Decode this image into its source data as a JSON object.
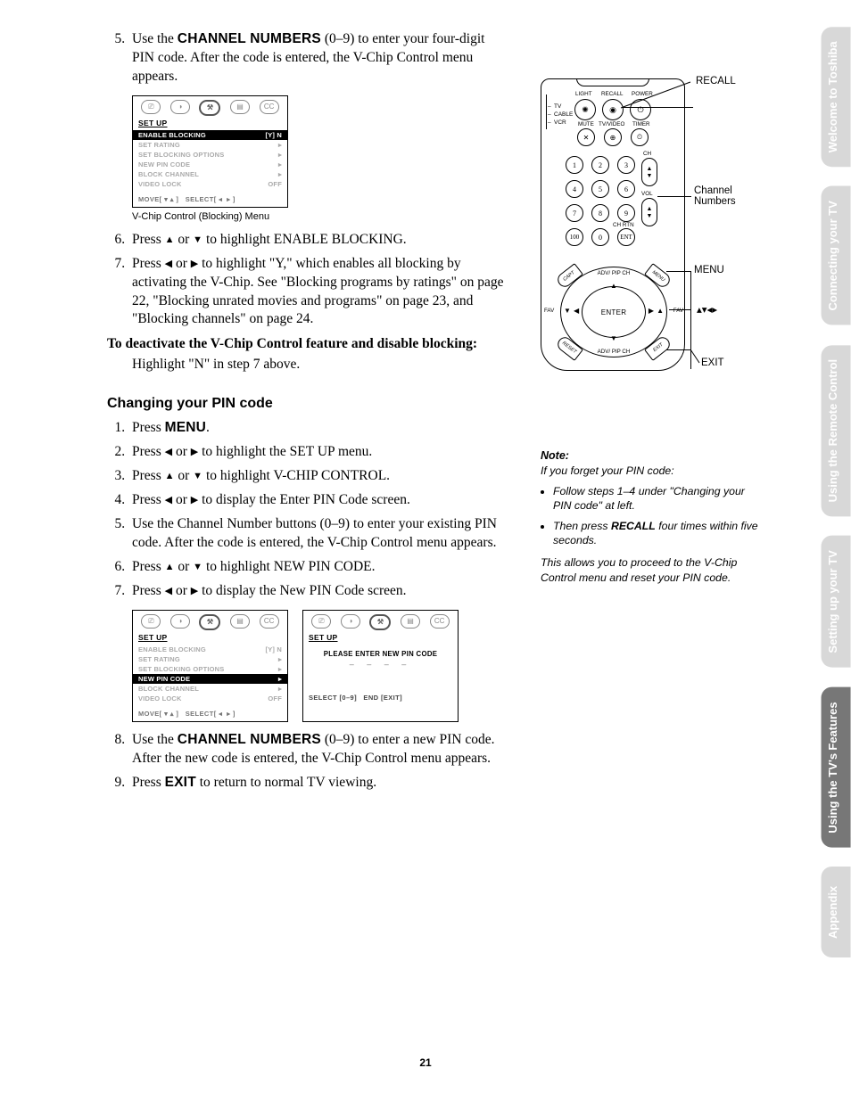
{
  "sidebar": {
    "tabs": [
      {
        "l1": "Welcome to",
        "l2": "Toshiba",
        "active": false
      },
      {
        "l1": "Connecting",
        "l2": "your TV",
        "active": false
      },
      {
        "l1": "Using the",
        "l2": "Remote Control",
        "active": false
      },
      {
        "l1": "Setting up",
        "l2": "your TV",
        "active": false
      },
      {
        "l1": "Using the TV's",
        "l2": "Features",
        "active": true
      },
      {
        "l1": "Appendix",
        "l2": "",
        "active": false
      }
    ]
  },
  "left": {
    "step5a": "Use the ",
    "step5b": "CHANNEL NUMBERS",
    "step5c": " (0–9) to enter your four-digit PIN code. After the code is entered, the V-Chip Control menu appears.",
    "osd1_caption": "V-Chip Control (Blocking) Menu",
    "step6a": "Press ",
    "step6b": " or ",
    "step6c": " to highlight ENABLE BLOCKING.",
    "step7a": "Press ",
    "step7b": " or ",
    "step7c": " to highlight \"Y,\" which enables all blocking by activating the V-Chip. See \"Blocking programs by ratings\" on page 22, \"Blocking unrated movies and programs\" on page 23, and \"Blocking channels\" on page 24.",
    "deact_title": "To deactivate the V-Chip Control feature and disable blocking:",
    "deact_body": "Highlight \"N\" in step 7 above.",
    "section2": "Changing your PIN code",
    "s2_1a": "Press ",
    "s2_1b": "MENU",
    "s2_1c": ".",
    "s2_2a": "Press ",
    "s2_2b": " or ",
    "s2_2c": " to highlight the SET UP menu.",
    "s2_3a": "Press ",
    "s2_3b": " or ",
    "s2_3c": " to highlight V-CHIP CONTROL.",
    "s2_4a": "Press ",
    "s2_4b": " or ",
    "s2_4c": " to display the Enter PIN Code screen.",
    "s2_5": "Use the Channel Number buttons (0–9) to enter your existing PIN code. After the code is entered, the V-Chip Control menu appears.",
    "s2_6a": "Press ",
    "s2_6b": " or ",
    "s2_6c": " to highlight NEW PIN CODE.",
    "s2_7a": "Press ",
    "s2_7b": " or ",
    "s2_7c": " to display the New PIN Code screen.",
    "s2_8a": "Use the ",
    "s2_8b": "CHANNEL NUMBERS",
    "s2_8c": " (0–9) to enter a new PIN code. After the new code is entered, the V-Chip Control menu appears.",
    "s2_9a": "Press ",
    "s2_9b": "EXIT",
    "s2_9c": " to return to normal TV viewing."
  },
  "osd": {
    "title": "SET UP",
    "rows": [
      {
        "k": "ENABLE BLOCKING",
        "v": "[Y] N"
      },
      {
        "k": "SET RATING",
        "v": "▸"
      },
      {
        "k": "SET BLOCKING OPTIONS",
        "v": "▸"
      },
      {
        "k": "NEW PIN CODE",
        "v": "▸"
      },
      {
        "k": "BLOCK CHANNEL",
        "v": "▸"
      },
      {
        "k": "VIDEO LOCK",
        "v": "OFF"
      }
    ],
    "foot": "MOVE[ ▾ ▴ ]   SELECT[ ◂  ▸ ]",
    "icons": [
      "⎚",
      "◑",
      "⚒",
      "▤",
      "CC"
    ],
    "pin_msg": "PLEASE ENTER NEW PIN CODE",
    "pin_dashes": "– – – –",
    "pin_foot": "SELECT [0–9]   END [EXIT]"
  },
  "remote": {
    "top_labels": [
      "LIGHT",
      "RECALL",
      "POWER"
    ],
    "row2_labels": [
      "MUTE",
      "TV/VIDEO",
      "TIMER"
    ],
    "selector": [
      "TV",
      "CABLE",
      "VCR"
    ],
    "numbers": [
      "1",
      "2",
      "3",
      "4",
      "5",
      "6",
      "7",
      "8",
      "9",
      "100",
      "0",
      "ENT"
    ],
    "ch": "CH",
    "vol": "VOL",
    "chrtn": "CH RTN",
    "enter": "ENTER",
    "adv": "ADV/\nPIP CH",
    "fav": "FAV",
    "corners": [
      "CAPT",
      "MENU",
      "RESET",
      "EXIT"
    ],
    "callouts": {
      "recall": "RECALL",
      "numbers": "Channel\nNumbers",
      "menu": "MENU",
      "arrows": "▴▾◂▸",
      "exit": "EXIT"
    }
  },
  "note": {
    "title": "Note:",
    "intro": "If you forget your PIN code:",
    "b1": "Follow steps 1–4 under \"Changing your PIN code\" at left.",
    "b2a": "Then press ",
    "b2b": "RECALL",
    "b2c": " four times within five seconds.",
    "tail": "This allows you to proceed to the V-Chip Control menu and reset your PIN code."
  },
  "pagenum": "21"
}
